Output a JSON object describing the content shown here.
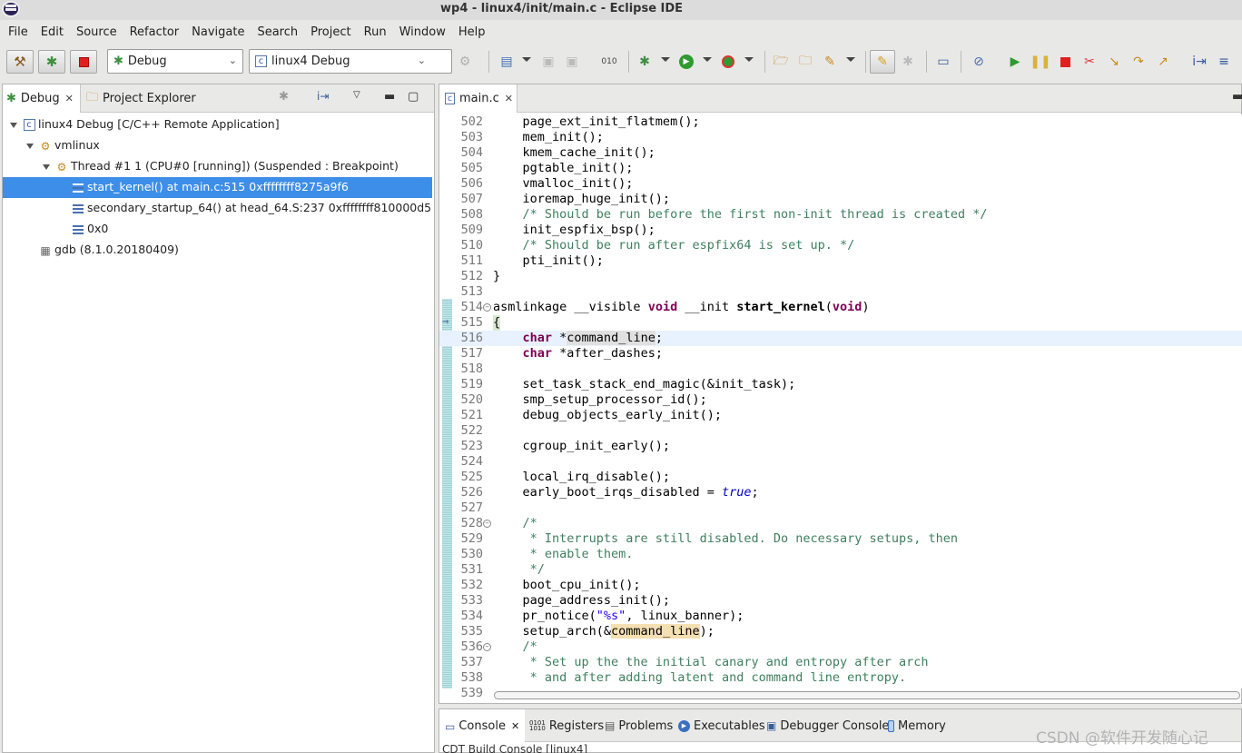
{
  "window": {
    "title": "wp4 - linux4/init/main.c - Eclipse IDE"
  },
  "menu": [
    "File",
    "Edit",
    "Source",
    "Refactor",
    "Navigate",
    "Search",
    "Project",
    "Run",
    "Window",
    "Help"
  ],
  "toolbar": {
    "perspective_combo": "Debug",
    "launch_config_combo": "linux4 Debug"
  },
  "left_panel": {
    "tabs": [
      {
        "label": "Debug",
        "icon": "debug-bug-icon"
      },
      {
        "label": "Project Explorer",
        "icon": "folder-icon"
      }
    ],
    "tree": [
      {
        "label": "linux4 Debug [C/C++ Remote Application]",
        "icon": "c-launch-icon",
        "depth": 0,
        "expanded": true
      },
      {
        "label": "vmlinux",
        "icon": "process-icon",
        "depth": 1,
        "expanded": true
      },
      {
        "label": "Thread #1 1 (CPU#0 [running]) (Suspended : Breakpoint)",
        "icon": "thread-suspended-icon",
        "depth": 2,
        "expanded": true
      },
      {
        "label": "start_kernel() at main.c:515 0xffffffff8275a9f6",
        "icon": "stack-frame-icon",
        "depth": 3,
        "selected": true
      },
      {
        "label": "secondary_startup_64() at head_64.S:237 0xffffffff810000d5",
        "icon": "stack-frame-icon",
        "depth": 3
      },
      {
        "label": "0x0",
        "icon": "stack-frame-icon",
        "depth": 3
      },
      {
        "label": "gdb (8.1.0.20180409)",
        "icon": "gdb-icon",
        "depth": 1
      }
    ]
  },
  "editor": {
    "tab_label": "main.c",
    "current_line": 515,
    "lines": [
      {
        "n": "502",
        "code": "    page_ext_init_flatmem();"
      },
      {
        "n": "503",
        "code": "    mem_init();"
      },
      {
        "n": "504",
        "code": "    kmem_cache_init();"
      },
      {
        "n": "505",
        "code": "    pgtable_init();"
      },
      {
        "n": "506",
        "code": "    vmalloc_init();"
      },
      {
        "n": "507",
        "code": "    ioremap_huge_init();"
      },
      {
        "n": "508",
        "code": "    /* Should be run before the first non-init thread is created */"
      },
      {
        "n": "509",
        "code": "    init_espfix_bsp();"
      },
      {
        "n": "510",
        "code": "    /* Should be run after espfix64 is set up. */"
      },
      {
        "n": "511",
        "code": "    pti_init();"
      },
      {
        "n": "512",
        "code": "}"
      },
      {
        "n": "513",
        "code": ""
      },
      {
        "n": "514",
        "code": "asmlinkage __visible void __init start_kernel(void)"
      },
      {
        "n": "515",
        "code": "{"
      },
      {
        "n": "516",
        "code": "    char *command_line;"
      },
      {
        "n": "517",
        "code": "    char *after_dashes;"
      },
      {
        "n": "518",
        "code": ""
      },
      {
        "n": "519",
        "code": "    set_task_stack_end_magic(&init_task);"
      },
      {
        "n": "520",
        "code": "    smp_setup_processor_id();"
      },
      {
        "n": "521",
        "code": "    debug_objects_early_init();"
      },
      {
        "n": "522",
        "code": ""
      },
      {
        "n": "523",
        "code": "    cgroup_init_early();"
      },
      {
        "n": "524",
        "code": ""
      },
      {
        "n": "525",
        "code": "    local_irq_disable();"
      },
      {
        "n": "526",
        "code": "    early_boot_irqs_disabled = true;"
      },
      {
        "n": "527",
        "code": ""
      },
      {
        "n": "528",
        "code": "    /*"
      },
      {
        "n": "529",
        "code": "     * Interrupts are still disabled. Do necessary setups, then"
      },
      {
        "n": "530",
        "code": "     * enable them."
      },
      {
        "n": "531",
        "code": "     */"
      },
      {
        "n": "532",
        "code": "    boot_cpu_init();"
      },
      {
        "n": "533",
        "code": "    page_address_init();"
      },
      {
        "n": "534",
        "code": "    pr_notice(\"%s\", linux_banner);"
      },
      {
        "n": "535",
        "code": "    setup_arch(&command_line);"
      },
      {
        "n": "536",
        "code": "    /*"
      },
      {
        "n": "537",
        "code": "     * Set up the the initial canary and entropy after arch"
      },
      {
        "n": "538",
        "code": "     * and after adding latent and command line entropy."
      },
      {
        "n": "539",
        "code": ""
      }
    ]
  },
  "bottom_panel": {
    "tabs": [
      {
        "label": "Console",
        "icon": "console-icon",
        "active": true
      },
      {
        "label": "Registers",
        "icon": "registers-icon"
      },
      {
        "label": "Problems",
        "icon": "problems-icon"
      },
      {
        "label": "Executables",
        "icon": "executables-icon"
      },
      {
        "label": "Debugger Console",
        "icon": "debugger-console-icon"
      },
      {
        "label": "Memory",
        "icon": "memory-icon"
      }
    ],
    "console_title": "CDT Build Console [linux4]"
  },
  "watermark": "CSDN @软件开发随心记"
}
